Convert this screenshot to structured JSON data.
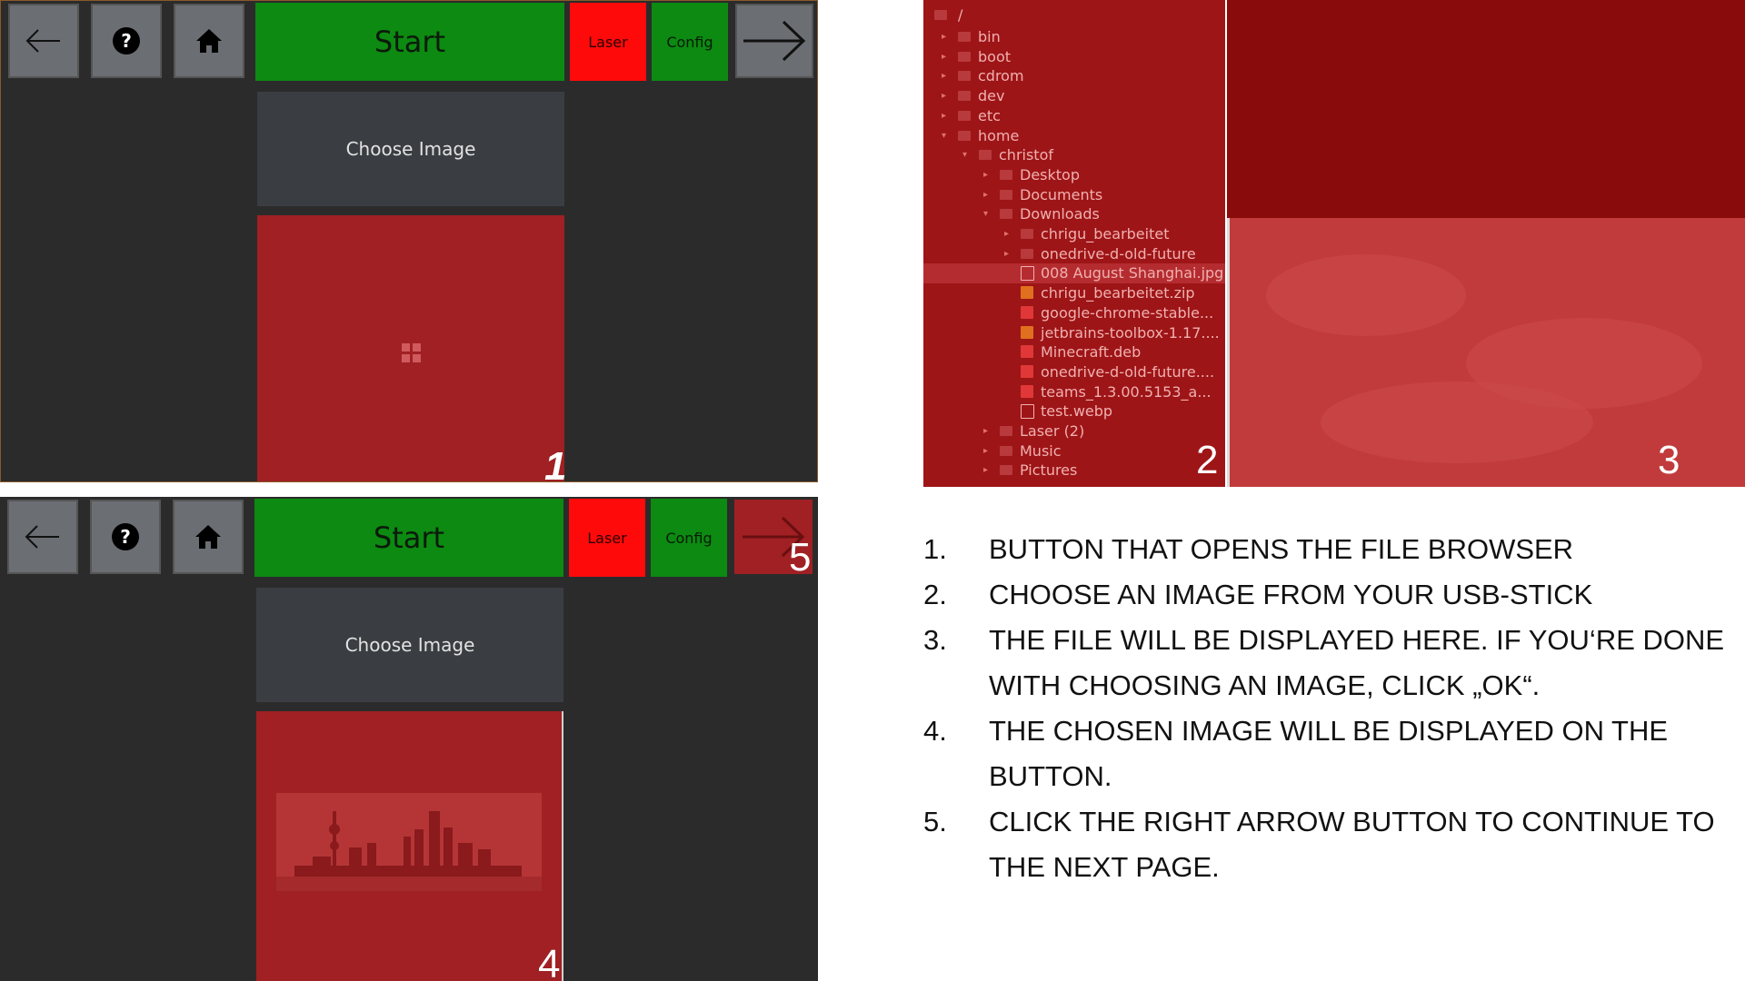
{
  "app": {
    "start_label": "Start",
    "laser_label": "Laser",
    "config_label": "Config",
    "choose_image_label": "Choose Image",
    "icons": {
      "back": "arrow-left-icon",
      "help": "help-icon",
      "home": "home-icon",
      "next": "arrow-right-icon",
      "placeholder": "image-placeholder-icon"
    },
    "colors": {
      "green": "#0c8a11",
      "red": "#ff0a0a",
      "gray": "#6b6e72",
      "dark": "#2b2b2b"
    }
  },
  "markers": {
    "m1": "1",
    "m2": "2",
    "m3": "3",
    "m4": "4",
    "m5": "5"
  },
  "file_browser": {
    "root": "/",
    "items": [
      {
        "name": "bin",
        "type": "folder"
      },
      {
        "name": "boot",
        "type": "folder"
      },
      {
        "name": "cdrom",
        "type": "folder"
      },
      {
        "name": "dev",
        "type": "folder"
      },
      {
        "name": "etc",
        "type": "folder"
      },
      {
        "name": "home",
        "type": "folder"
      },
      {
        "name": "christof",
        "type": "folder"
      },
      {
        "name": "Desktop",
        "type": "folder"
      },
      {
        "name": "Documents",
        "type": "folder"
      },
      {
        "name": "Downloads",
        "type": "folder"
      },
      {
        "name": "chrigu_bearbeitet",
        "type": "folder"
      },
      {
        "name": "onedrive-d-old-future",
        "type": "folder"
      },
      {
        "name": "008 August Shanghai.jpg",
        "type": "file"
      },
      {
        "name": "chrigu_bearbeitet.zip",
        "type": "archive"
      },
      {
        "name": "google-chrome-stable...",
        "type": "package"
      },
      {
        "name": "jetbrains-toolbox-1.17....",
        "type": "archive"
      },
      {
        "name": "Minecraft.deb",
        "type": "package"
      },
      {
        "name": "onedrive-d-old-future....",
        "type": "package"
      },
      {
        "name": "teams_1.3.00.5153_a...",
        "type": "package"
      },
      {
        "name": "test.webp",
        "type": "file"
      },
      {
        "name": "Laser (2)",
        "type": "folder"
      },
      {
        "name": "Music",
        "type": "folder"
      },
      {
        "name": "Pictures",
        "type": "folder"
      }
    ]
  },
  "instructions": [
    {
      "num": "1.",
      "text": "BUTTON THAT OPENS THE FILE BROWSER"
    },
    {
      "num": "2.",
      "text": "CHOOSE AN IMAGE FROM YOUR USB-STICK"
    },
    {
      "num": "3.",
      "text": "THE FILE WILL BE DISPLAYED HERE. IF YOU‘RE DONE WITH CHOOSING AN IMAGE, CLICK „OK“."
    },
    {
      "num": "4.",
      "text": "THE CHOSEN IMAGE WILL BE DISPLAYED ON THE BUTTON."
    },
    {
      "num": "5.",
      "text": "CLICK THE RIGHT ARROW BUTTON TO CONTINUE TO THE NEXT PAGE."
    }
  ]
}
